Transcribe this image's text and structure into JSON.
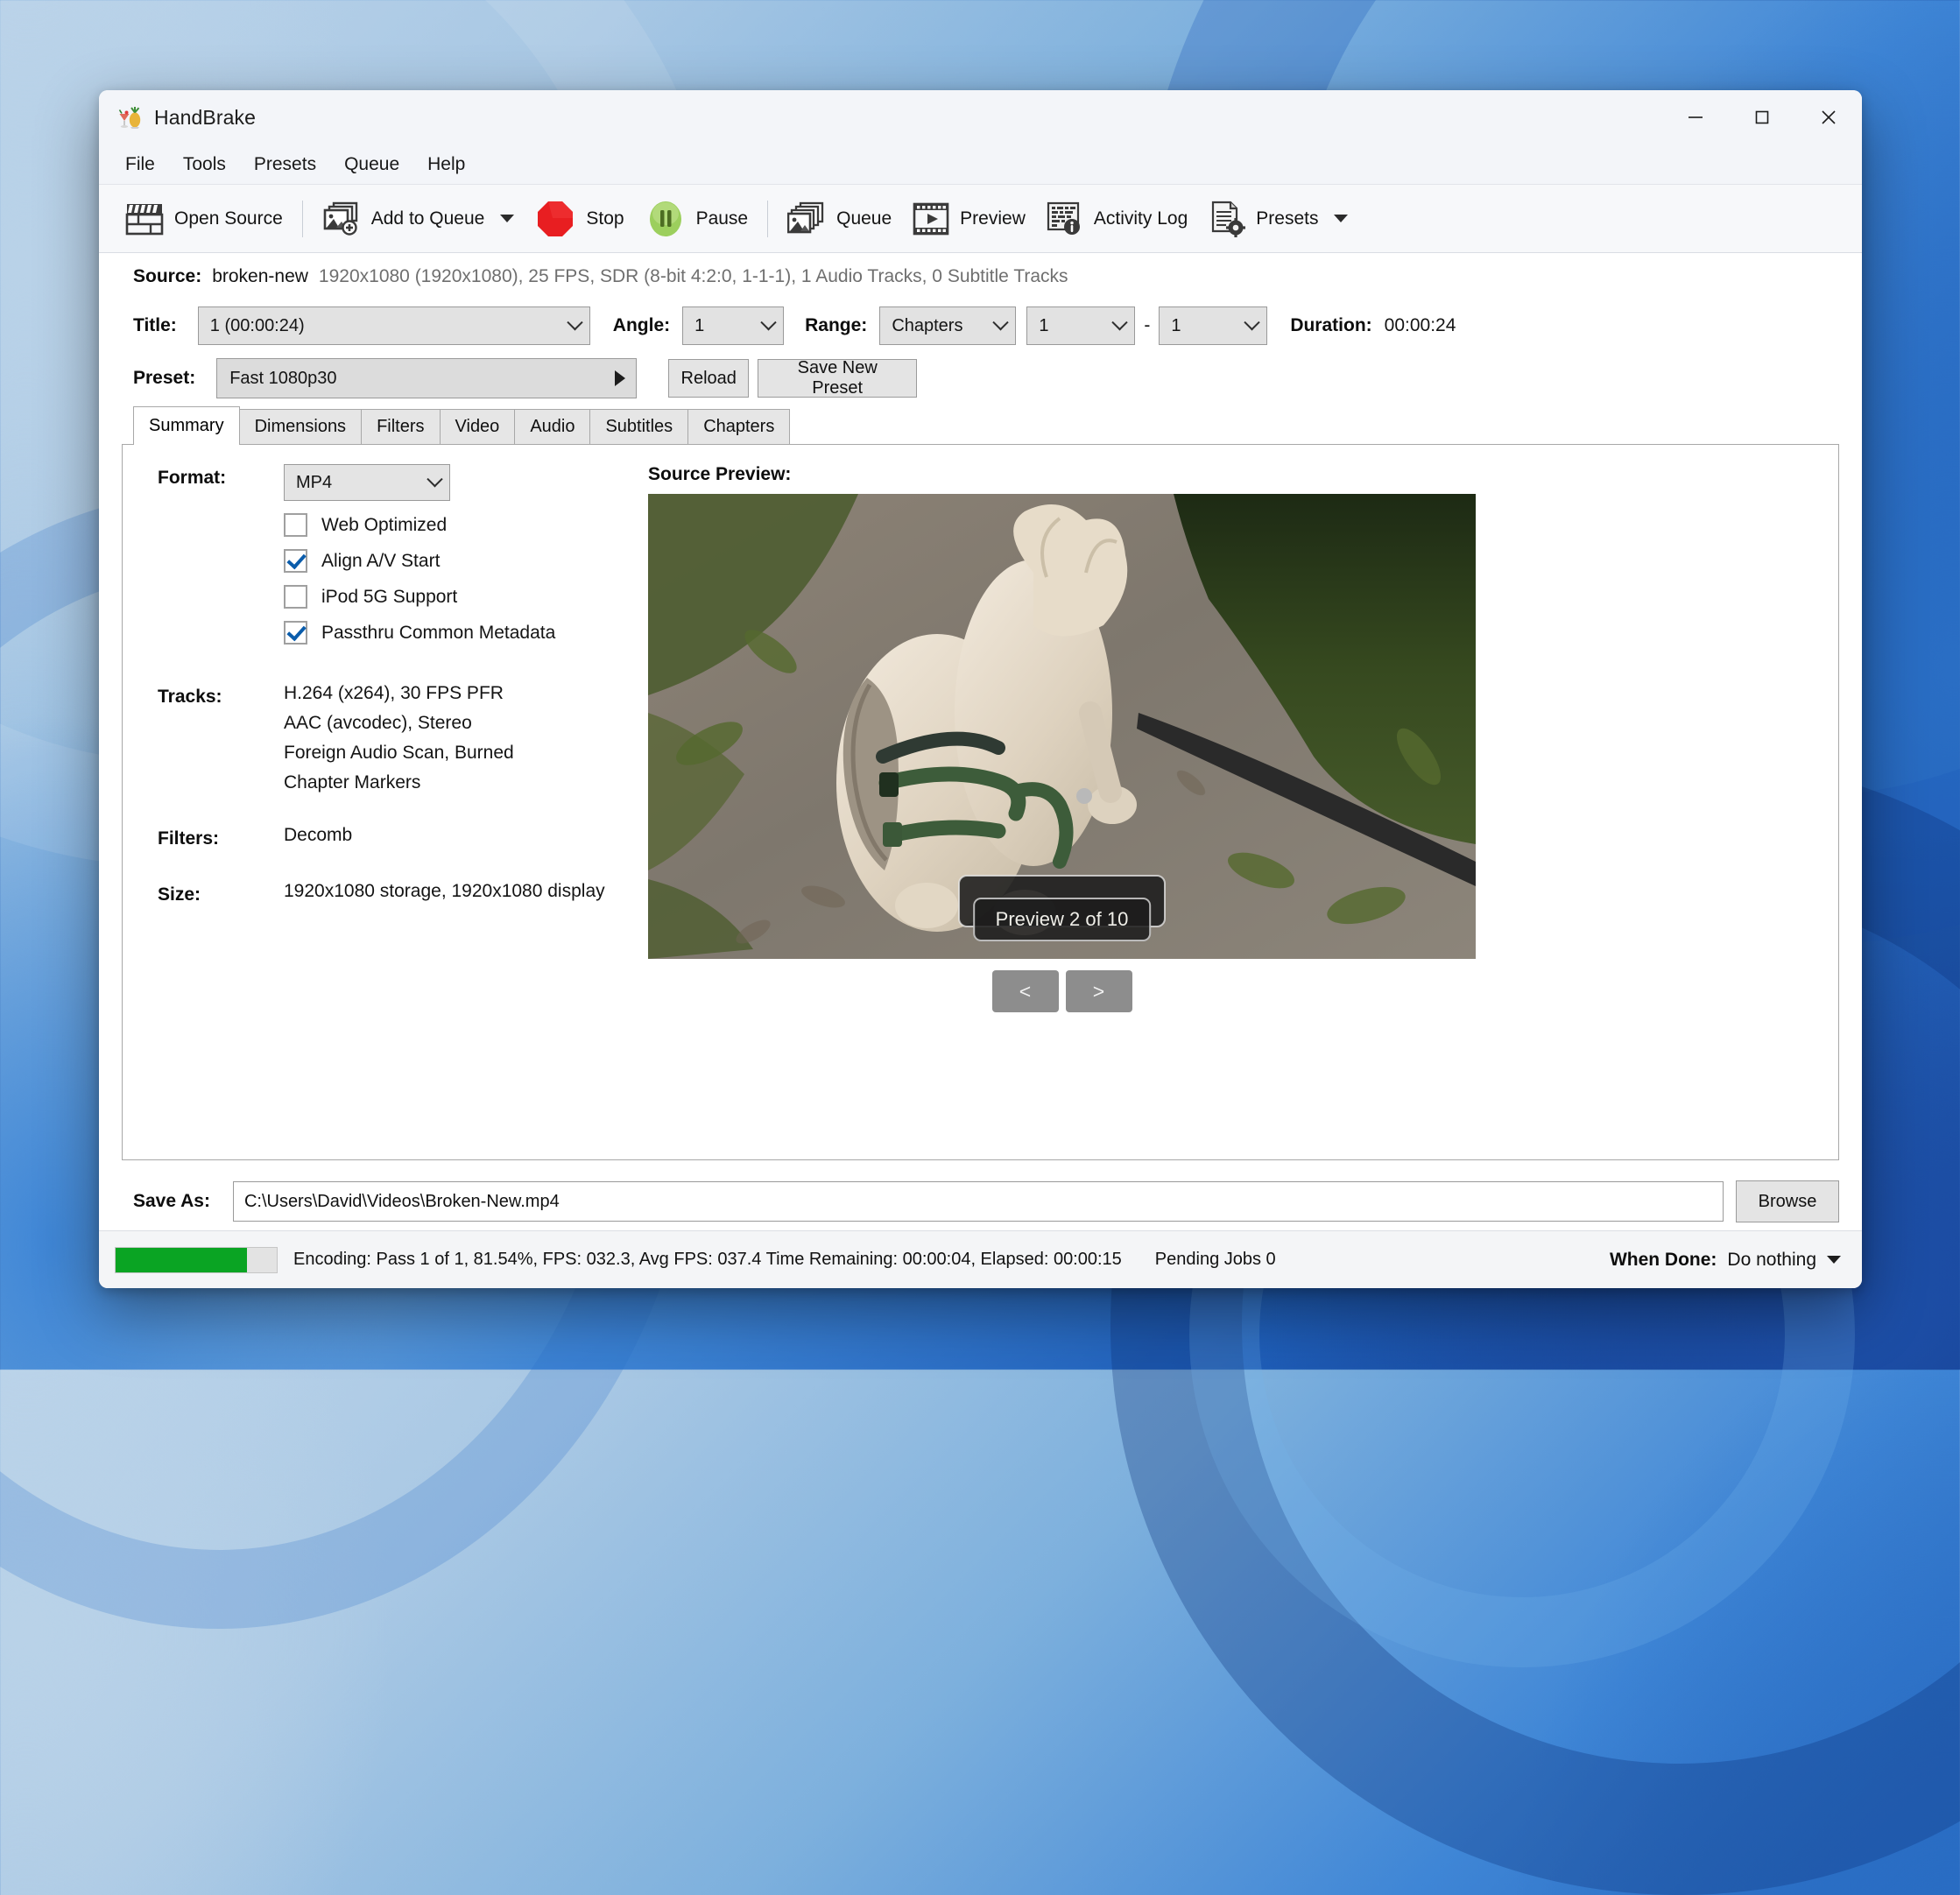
{
  "window": {
    "title": "HandBrake",
    "app_icon": "handbrake-cocktail-pineapple-icon",
    "minimize_label": "—",
    "maximize_label": "❑",
    "close_label": "✕"
  },
  "menubar": {
    "items": [
      {
        "label": "File"
      },
      {
        "label": "Tools"
      },
      {
        "label": "Presets"
      },
      {
        "label": "Queue"
      },
      {
        "label": "Help"
      }
    ]
  },
  "toolbar": {
    "items": [
      {
        "label": "Open Source",
        "icon": "film-clapper-icon",
        "has_caret": false
      },
      {
        "label": "Add to Queue",
        "icon": "add-image-icon",
        "has_caret": true
      },
      {
        "label": "Stop",
        "icon": "stop-octagon-icon",
        "has_caret": false
      },
      {
        "label": "Pause",
        "icon": "pause-circle-icon",
        "has_caret": false
      },
      {
        "label": "Queue",
        "icon": "image-stack-icon",
        "has_caret": false
      },
      {
        "label": "Preview",
        "icon": "film-play-icon",
        "has_caret": false
      },
      {
        "label": "Activity Log",
        "icon": "log-info-icon",
        "has_caret": false
      },
      {
        "label": "Presets",
        "icon": "document-gear-icon",
        "has_caret": true
      }
    ]
  },
  "source": {
    "label": "Source:",
    "name": "broken-new",
    "details": "1920x1080 (1920x1080), 25 FPS, SDR (8-bit 4:2:0, 1-1-1), 1 Audio Tracks, 0 Subtitle Tracks"
  },
  "title_row": {
    "title_label": "Title:",
    "title_value": "1 (00:00:24)",
    "angle_label": "Angle:",
    "angle_value": "1",
    "range_label": "Range:",
    "range_value": "Chapters",
    "range_start": "1",
    "range_separator": "-",
    "range_end": "1",
    "duration_label": "Duration:",
    "duration_value": "00:00:24"
  },
  "preset_row": {
    "label": "Preset:",
    "value": "Fast 1080p30",
    "reload_label": "Reload",
    "save_new_label": "Save New Preset"
  },
  "tabs": [
    {
      "label": "Summary",
      "active": true
    },
    {
      "label": "Dimensions",
      "active": false
    },
    {
      "label": "Filters",
      "active": false
    },
    {
      "label": "Video",
      "active": false
    },
    {
      "label": "Audio",
      "active": false
    },
    {
      "label": "Subtitles",
      "active": false
    },
    {
      "label": "Chapters",
      "active": false
    }
  ],
  "summary": {
    "format_label": "Format:",
    "format_value": "MP4",
    "checkboxes": [
      {
        "label": "Web Optimized",
        "checked": false
      },
      {
        "label": "Align A/V Start",
        "checked": true
      },
      {
        "label": "iPod 5G Support",
        "checked": false
      },
      {
        "label": "Passthru Common Metadata",
        "checked": true
      }
    ],
    "tracks_label": "Tracks:",
    "tracks": [
      "H.264 (x264), 30 FPS PFR",
      "AAC (avcodec), Stereo",
      "Foreign Audio Scan, Burned",
      "Chapter Markers"
    ],
    "filters_label": "Filters:",
    "filters_value": "Decomb",
    "size_label": "Size:",
    "size_value": "1920x1080 storage, 1920x1080 display"
  },
  "preview": {
    "title": "Source Preview:",
    "badge": "Preview 2 of 10",
    "prev_label": "<",
    "next_label": ">",
    "scene_description": "dog-on-path-with-green-harness-and-leash"
  },
  "save_as": {
    "label": "Save As:",
    "path": "C:\\Users\\David\\Videos\\Broken-New.mp4",
    "browse_label": "Browse"
  },
  "status": {
    "progress_percent": 81.54,
    "progress_color": "#0aa423",
    "text": "Encoding: Pass 1 of 1,  81.54%, FPS: 032.3,  Avg FPS: 037.4 Time Remaining: 00:00:04,  Elapsed: 00:00:15",
    "pending_jobs": "Pending Jobs 0",
    "when_done_label": "When Done:",
    "when_done_value": "Do nothing"
  }
}
